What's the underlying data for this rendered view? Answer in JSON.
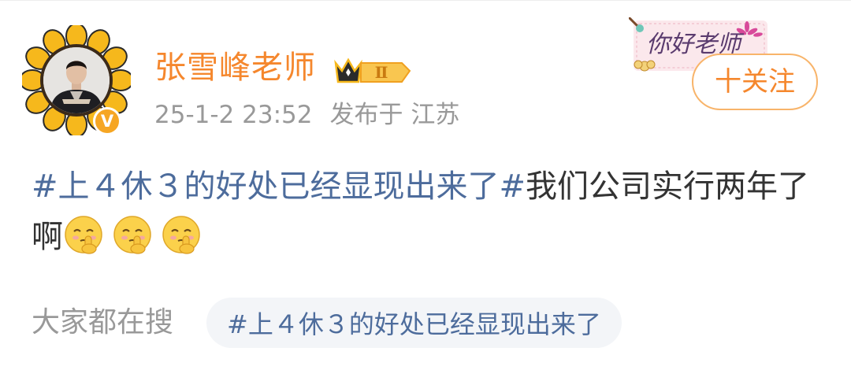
{
  "post": {
    "username": "张雪峰老师",
    "level_badge": "Ⅱ",
    "verified_mark": "V",
    "time": "25-1-2 23:52",
    "location": "发布于 江苏",
    "follow_label": "十关注",
    "sticker_text": "你好老师",
    "topic": "#上４休３的好处已经显现出来了#",
    "text": "我们公司实行两年了啊",
    "emojis": [
      "shush-emoji",
      "shush-emoji",
      "shush-emoji"
    ]
  },
  "search": {
    "label": "大家都在搜",
    "chip": "#上４休３的好处已经显现出来了"
  },
  "colors": {
    "username": "#f5872d",
    "topic": "#4d6c9c",
    "meta": "#999999",
    "text": "#333333",
    "follow_border": "#f8b46a",
    "chip_bg": "#f3f5f8"
  }
}
